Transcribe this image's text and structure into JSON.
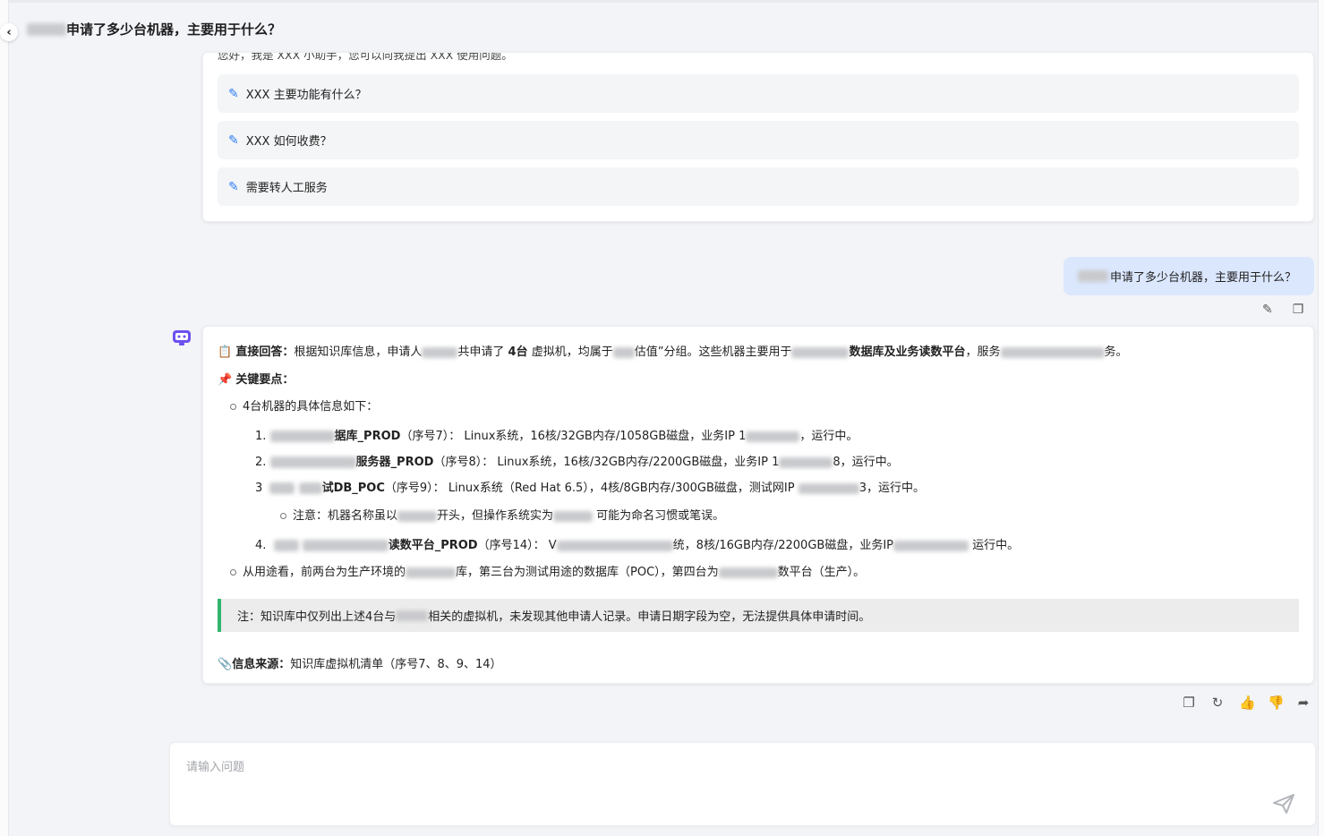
{
  "header": {
    "back_icon": "chevron-left-icon",
    "title": "申请了多少台机器，主要用于什么？"
  },
  "welcome": {
    "text": "您好，我是 XXX 小助手，您可以向我提出 XXX 使用问题。",
    "suggestions": [
      "XXX 主要功能有什么？",
      "XXX 如何收费？",
      "需要转人工服务"
    ],
    "suggest_icon": "edit-icon"
  },
  "user_message": {
    "text": "申请了多少台机器，主要用于什么？",
    "tools": [
      "edit-icon",
      "copy-icon"
    ]
  },
  "answer": {
    "direct_label": "直接回答：",
    "direct_text_1": "根据知识库信息，申请人",
    "direct_text_2": "共申请了",
    "direct_bold": "4台",
    "direct_text_3": "虚拟机，均属于",
    "direct_text_4": "估值”分组。这些机器主要用于",
    "direct_bold_2": "数据库及业务读数平台",
    "direct_text_5": "，服务",
    "direct_text_6": "务。",
    "key_label": "关键要点：",
    "sub_intro": "4台机器的具体信息如下：",
    "items": [
      {
        "num": "1.",
        "name": "据库_PROD",
        "seq": "（序号7）：",
        "desc": "Linux系统，16核/32GB内存/1058GB磁盘，业务IP 1",
        "tail": "，运行中。"
      },
      {
        "num": "2.",
        "name": "服务器_PROD",
        "seq": "（序号8）：",
        "desc": "Linux系统，16核/32GB内存/2200GB磁盘，业务IP 1",
        "tail": "8，运行中。"
      },
      {
        "num": "3",
        "name": "试DB_POC",
        "seq": "（序号9）：",
        "desc": "Linux系统（Red Hat 6.5），4核/8GB内存/300GB磁盘，测试网IP",
        "tail": "3，运行中。"
      },
      {
        "num": "4.",
        "name": "读数平台_PROD",
        "seq": "（序号14）：",
        "desc": "V",
        "tail": "统，8核/16GB内存/2200GB磁盘，业务IP",
        "tail2": "运行中。"
      }
    ],
    "note_sub_1": "注意：机器名称虽以",
    "note_sub_2": "开头，但操作系统实为",
    "note_sub_3": "可能为命名习惯或笔误。",
    "usage_1": "从用途看，前两台为生产环境的",
    "usage_2": "库，第三台为测试用途的数据库（POC），第四台为",
    "usage_3": "数平台（生产）。",
    "note_1": "注：知识库中仅列出上述4台与",
    "note_2": "相关的虚拟机，未发现其他申请人记录。申请日期字段为空，无法提供具体申请时间。",
    "source_label": "信息来源：",
    "source_text": "知识库虚拟机清单（序号7、8、9、14）"
  },
  "bottom_tools": [
    "copy-icon",
    "refresh-icon",
    "thumbs-up-icon",
    "thumbs-down-icon",
    "share-icon"
  ],
  "input": {
    "placeholder": "请输入问题",
    "value": ""
  }
}
